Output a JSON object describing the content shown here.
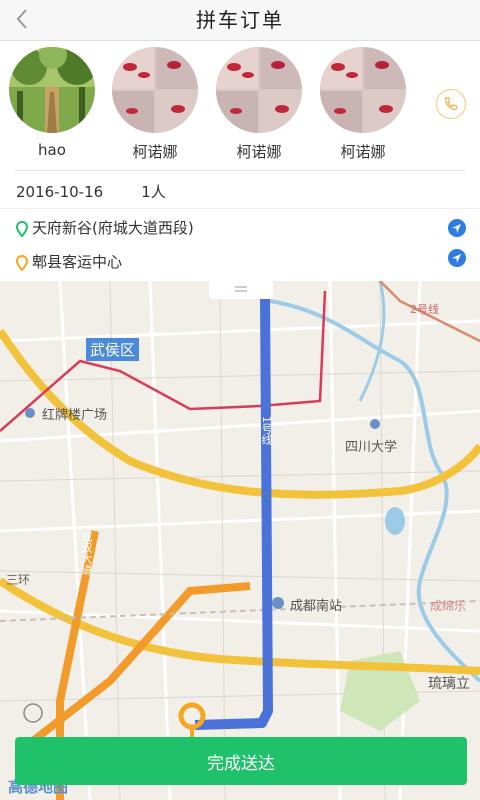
{
  "header": {
    "title": "拼车订单",
    "back_icon": "chevron-left-icon"
  },
  "passengers": [
    {
      "name": "hao",
      "avatar": "forest-path-photo"
    },
    {
      "name": "柯诺娜",
      "avatar": "nail-art-photo"
    },
    {
      "name": "柯诺娜",
      "avatar": "nail-art-photo"
    },
    {
      "name": "柯诺娜",
      "avatar": "nail-art-photo"
    }
  ],
  "phone_icon": "phone-icon",
  "order": {
    "date": "2016-10-16",
    "count": "1人"
  },
  "route": {
    "start": "天府新谷(府城大道西段)",
    "end": "郫县客运中心"
  },
  "map": {
    "labels": {
      "district": "武侯区",
      "plaza": "红牌楼广场",
      "university": "四川大学",
      "station": "成都南站",
      "liuli": "琉璃立",
      "line1": "1号线",
      "line2": "2号线",
      "ring": "三环",
      "chengdu": "成绵乐",
      "road": "成双大道"
    },
    "logo": "高德地图"
  },
  "complete_button": "完成送达",
  "colors": {
    "accent_green": "#1fc16a",
    "route_blue": "#4a72d8",
    "marker_orange": "#f5a623"
  }
}
